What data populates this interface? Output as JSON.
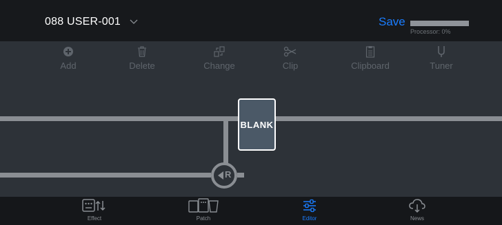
{
  "header": {
    "patch_name": "088 USER-001",
    "save_label": "Save",
    "processor_label": "Processor: 0%",
    "processor_value_percent": 0
  },
  "toolbar": {
    "items": [
      {
        "label": "Add",
        "icon": "plus-circle-icon"
      },
      {
        "label": "Delete",
        "icon": "trash-icon"
      },
      {
        "label": "Change",
        "icon": "change-icon"
      },
      {
        "label": "Clip",
        "icon": "scissors-icon"
      },
      {
        "label": "Clipboard",
        "icon": "clipboard-icon"
      },
      {
        "label": "Tuner",
        "icon": "tuner-icon"
      }
    ]
  },
  "chain": {
    "block_label": "BLANK",
    "return_label": "R"
  },
  "tabs": [
    {
      "label": "Effect",
      "icon": "effect-icon",
      "active": false
    },
    {
      "label": "Patch",
      "icon": "patch-icon",
      "active": false
    },
    {
      "label": "Editor",
      "icon": "editor-sliders-icon",
      "active": true
    },
    {
      "label": "News",
      "icon": "cloud-download-icon",
      "active": false
    }
  ],
  "colors": {
    "accent": "#1a7dff",
    "background": "#2d3238",
    "topbar": "#17191c",
    "bottombar": "#15171a",
    "block_fill": "#4b5967"
  }
}
